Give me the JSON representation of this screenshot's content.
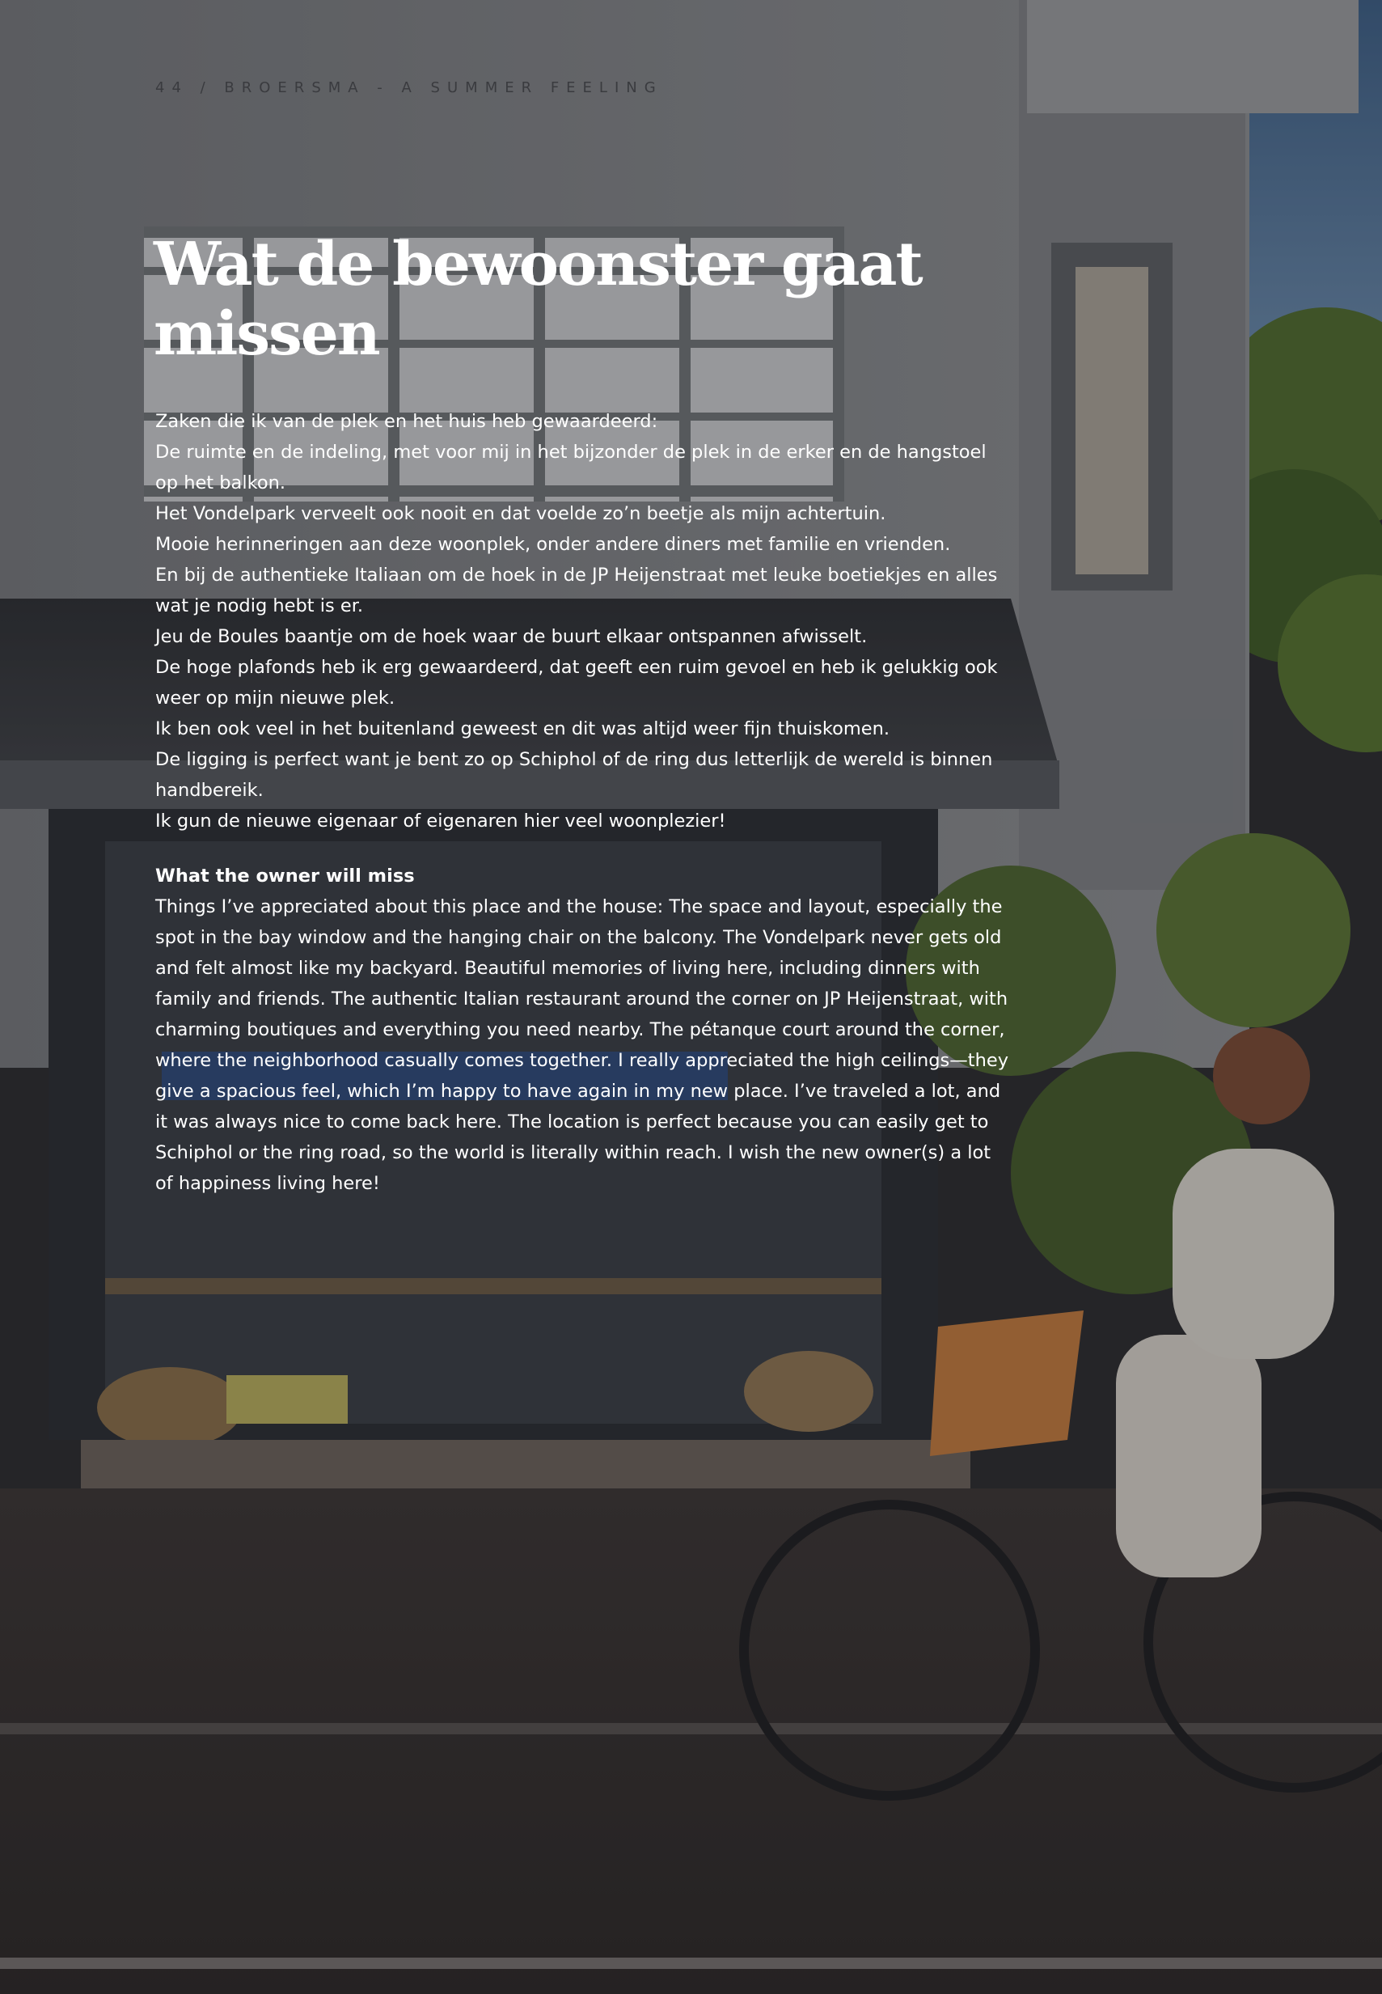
{
  "header": {
    "running_title": "44 / BROERSMA - A SUMMER FEELING"
  },
  "title": "Wat de bewoonster gaat missen",
  "dutch_paragraphs": [
    "Zaken die ik van de plek en het huis heb gewaardeerd:",
    "De ruimte en de indeling, met voor mij in het bijzonder de plek in de erker en de hangstoel op het balkon.",
    "Het Vondelpark verveelt ook nooit en dat voelde zo’n beetje als mijn achtertuin.",
    "Mooie herinneringen aan deze woonplek, onder andere diners met familie en vrienden.",
    "En bij de authentieke Italiaan om de hoek in de JP Heijenstraat met leuke boetiekjes en alles wat je nodig hebt is er.",
    "Jeu de Boules baantje om de hoek waar de buurt elkaar ontspannen afwisselt.",
    "De hoge plafonds heb ik erg gewaardeerd, dat geeft een ruim gevoel en heb ik gelukkig ook weer op mijn nieuwe plek.",
    "Ik ben ook veel in het buitenland geweest en dit was altijd weer fijn thuiskomen.",
    "De ligging is perfect want je bent zo op Schiphol of de ring dus letterlijk de wereld is binnen handbereik.",
    "Ik gun de nieuwe eigenaar of eigenaren hier veel woonplezier!"
  ],
  "english": {
    "heading": "What the owner will miss",
    "text": "Things I’ve appreciated about this place and the house: The space and layout, especially the spot in the bay window and the hanging chair on the balcony. The Vondelpark never gets old and felt almost like my backyard. Beautiful memories of living here, including dinners with family and friends. The authentic Italian restaurant around the corner on JP Heijenstraat, with charming boutiques and everything you need nearby. The pétanque court around the corner, where the neighborhood casually comes together. I really appreciated the high ceilings—they give a spacious feel, which I’m happy to have again in my new place. I’ve traveled a lot, and it was always nice to come back here. The location is perfect because you can easily get to Schiphol or the ring road, so the world is literally within reach. I wish the new owner(s) a lot of happiness living here!"
  },
  "colors": {
    "text": "#ffffff",
    "header_text": "#3a3b3f",
    "overlay": "#141418"
  }
}
